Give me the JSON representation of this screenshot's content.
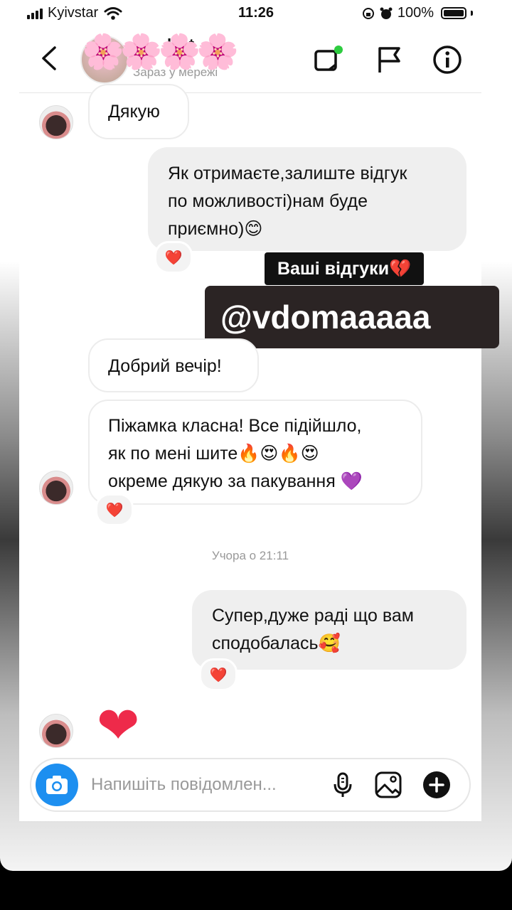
{
  "status_bar": {
    "carrier": "Kyivstar",
    "time": "11:26",
    "battery": "100%"
  },
  "header": {
    "contact_name": "k   at",
    "contact_status": "Зараз у мережі",
    "avatar_emoji": "🌸🌸🌸🌸"
  },
  "messages": [
    {
      "side": "in",
      "text": "Дякую"
    },
    {
      "side": "out",
      "lines": [
        "Як отримаєте,залиште відгук",
        "по можливості)нам буде",
        "приємно)😊"
      ],
      "reaction": "❤️"
    },
    {
      "side": "in",
      "text": "Добрий вечір!"
    },
    {
      "side": "in",
      "lines": [
        "Піжамка класна! Все підійшло,",
        "як по мені шите🔥😍🔥😍",
        "окреме дякую за пакування 💜"
      ],
      "reaction": "❤️"
    },
    {
      "side": "out",
      "lines": [
        "Супер,дуже раді що вам",
        "сподобалась🥰"
      ],
      "reaction": "❤️"
    },
    {
      "side": "in",
      "text": "❤"
    }
  ],
  "timestamp": "Учора о 21:11",
  "overlay": {
    "reviews_tag": "Ваші відгуки💔",
    "account_tag": "@vdomaaaaa"
  },
  "composer": {
    "placeholder": "Напишіть повідомлен..."
  },
  "colors": {
    "accent_camera": "#1d8ff0",
    "heart": "#ee2a4a",
    "outgoing_bubble": "#efefef"
  }
}
